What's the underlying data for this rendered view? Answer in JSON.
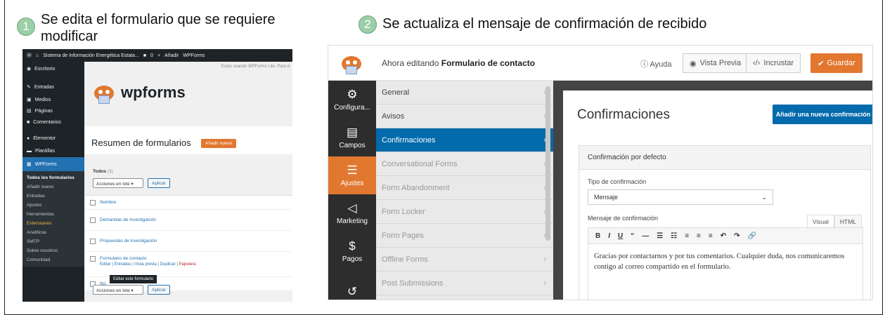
{
  "steps": [
    {
      "number": "1",
      "text": "Se edita el formulario que se requiere modificar"
    },
    {
      "number": "2",
      "text": "Se actualiza el mensaje de confirmación de recibido"
    }
  ],
  "left_shot": {
    "adminbar": {
      "site": "Sistema de Información Energética Estata...",
      "comments": "0",
      "new": "Añadir",
      "wpforms": "WPForms"
    },
    "notice": "Estás usando WPForms Lite. Para d",
    "sidebar": [
      "Escritorio",
      "Entradas",
      "Medios",
      "Páginas",
      "Comentarios",
      "Elementor",
      "Plantillas",
      "WPForms"
    ],
    "submenu": [
      "Todos los formularios",
      "Añadir nuevo",
      "Entradas",
      "Ajustes",
      "Herramientas",
      "Extensiones",
      "Analíticas",
      "SMTP",
      "Sobre nosotros",
      "Comunidad"
    ],
    "logo_text": "wpforms",
    "title": "Resumen de formularios",
    "add_new": "Añadir nuevo",
    "todos": "Todos",
    "todos_count": "(3)",
    "bulk": "Acciones en lote",
    "apply": "Aplicar",
    "col_name": "Nombre",
    "forms": [
      "Demandas de investigación",
      "Propuestas de investigación",
      "Formulario de contacto"
    ],
    "row_actions": {
      "edit": "Editar",
      "entries": "Entradas",
      "preview": "Vista previa",
      "duplicate": "Duplicar",
      "trash": "Papelera"
    },
    "tooltip": "Editar este formulario",
    "name_partial": "No"
  },
  "right_shot": {
    "editing_prefix": "Ahora editando",
    "form_name": "Formulario de contacto",
    "help": "Ayuda",
    "preview": "Vista Previa",
    "embed": "Incrustar",
    "save": "Guardar",
    "nav": [
      "Configura...",
      "Campos",
      "Ajustes",
      "Marketing",
      "Pagos"
    ],
    "subnav": [
      "General",
      "Avisos",
      "Confirmaciones",
      "Conversational Forms",
      "Form Abandonment",
      "Form Locker",
      "Form Pages",
      "Offline Forms",
      "Post Submissions"
    ],
    "panel_title": "Confirmaciones",
    "add_confirmation": "Añadir una nueva confirmación",
    "card_title": "Confirmación por defecto",
    "type_label": "Tipo de confirmación",
    "type_value": "Mensaje",
    "message_label": "Mensaje de confirmación",
    "tab_visual": "Visual",
    "tab_html": "HTML",
    "toolbar": [
      "B",
      "I",
      "U",
      "“",
      "—",
      "☰",
      "☷",
      "≡",
      "≡",
      "≡",
      "↶",
      "↷",
      "🔗"
    ],
    "message": "Gracias por contactarnos y por tus comentarios. Cualquier duda, nos comunicaremos contigo al correo compartido en el formulario.",
    "colors": {
      "orange": "#e27730",
      "blue": "#036aab"
    }
  }
}
